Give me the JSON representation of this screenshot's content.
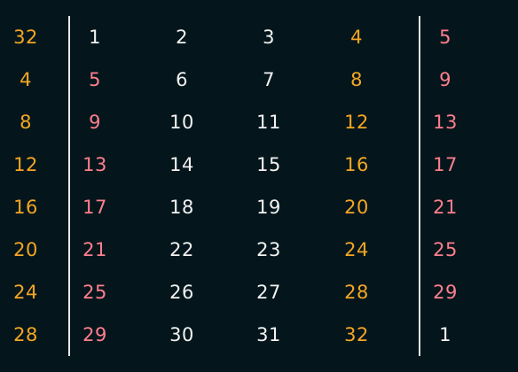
{
  "colors": {
    "background": "#04161c",
    "orange": "#f5a623",
    "pink": "#ff7f8e",
    "white": "#f2f2f2",
    "divider": "#e8e8e8"
  },
  "rows": [
    [
      {
        "text": "32",
        "color": "orange"
      },
      {
        "text": "1",
        "color": "white"
      },
      {
        "text": "2",
        "color": "white"
      },
      {
        "text": "3",
        "color": "white"
      },
      {
        "text": "4",
        "color": "orange"
      },
      {
        "text": "5",
        "color": "pink"
      }
    ],
    [
      {
        "text": "4",
        "color": "orange"
      },
      {
        "text": "5",
        "color": "pink"
      },
      {
        "text": "6",
        "color": "white"
      },
      {
        "text": "7",
        "color": "white"
      },
      {
        "text": "8",
        "color": "orange"
      },
      {
        "text": "9",
        "color": "pink"
      }
    ],
    [
      {
        "text": "8",
        "color": "orange"
      },
      {
        "text": "9",
        "color": "pink"
      },
      {
        "text": "10",
        "color": "white"
      },
      {
        "text": "11",
        "color": "white"
      },
      {
        "text": "12",
        "color": "orange"
      },
      {
        "text": "13",
        "color": "pink"
      }
    ],
    [
      {
        "text": "12",
        "color": "orange"
      },
      {
        "text": "13",
        "color": "pink"
      },
      {
        "text": "14",
        "color": "white"
      },
      {
        "text": "15",
        "color": "white"
      },
      {
        "text": "16",
        "color": "orange"
      },
      {
        "text": "17",
        "color": "pink"
      }
    ],
    [
      {
        "text": "16",
        "color": "orange"
      },
      {
        "text": "17",
        "color": "pink"
      },
      {
        "text": "18",
        "color": "white"
      },
      {
        "text": "19",
        "color": "white"
      },
      {
        "text": "20",
        "color": "orange"
      },
      {
        "text": "21",
        "color": "pink"
      }
    ],
    [
      {
        "text": "20",
        "color": "orange"
      },
      {
        "text": "21",
        "color": "pink"
      },
      {
        "text": "22",
        "color": "white"
      },
      {
        "text": "23",
        "color": "white"
      },
      {
        "text": "24",
        "color": "orange"
      },
      {
        "text": "25",
        "color": "pink"
      }
    ],
    [
      {
        "text": "24",
        "color": "orange"
      },
      {
        "text": "25",
        "color": "pink"
      },
      {
        "text": "26",
        "color": "white"
      },
      {
        "text": "27",
        "color": "white"
      },
      {
        "text": "28",
        "color": "orange"
      },
      {
        "text": "29",
        "color": "pink"
      }
    ],
    [
      {
        "text": "28",
        "color": "orange"
      },
      {
        "text": "29",
        "color": "pink"
      },
      {
        "text": "30",
        "color": "white"
      },
      {
        "text": "31",
        "color": "white"
      },
      {
        "text": "32",
        "color": "orange"
      },
      {
        "text": "1",
        "color": "white"
      }
    ]
  ]
}
